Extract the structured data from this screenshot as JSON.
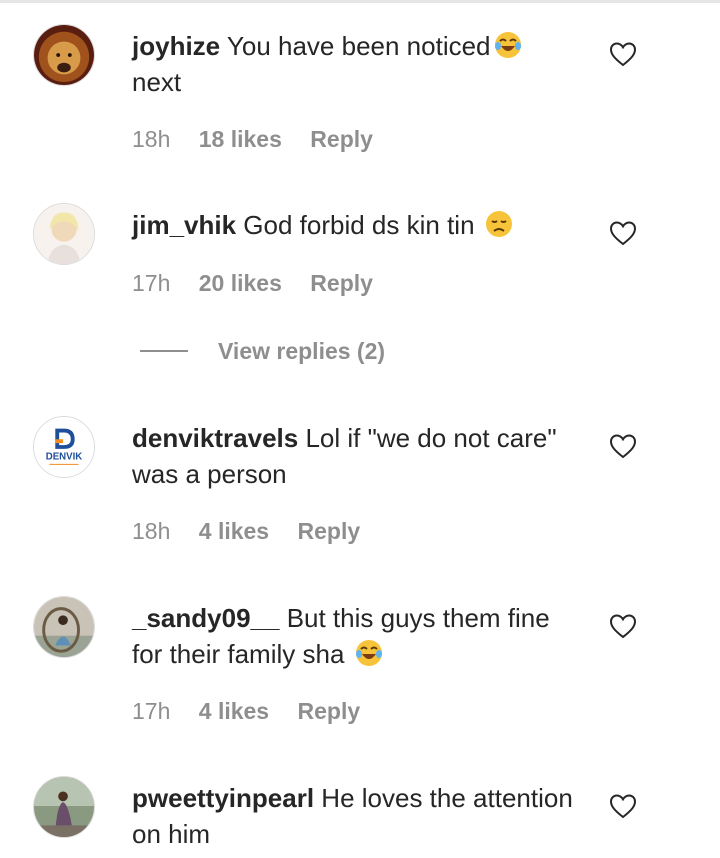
{
  "comments": [
    {
      "username": "joyhize",
      "text": "You have been noticed",
      "text2": "next",
      "emoji": "tears-of-joy-emoji",
      "time": "18h",
      "likes": "18 likes",
      "reply": "Reply"
    },
    {
      "username": "jim_vhik",
      "text": "God forbid ds kin tin",
      "emoji": "disappointed-face-emoji",
      "time": "17h",
      "likes": "20 likes",
      "reply": "Reply"
    },
    {
      "username": "denviktravels",
      "text": "Lol if \"we do not care\" was a person",
      "avatar_logo_text": "DENVIK",
      "time": "18h",
      "likes": "4 likes",
      "reply": "Reply"
    },
    {
      "username": "_sandy09__",
      "text": "But this guys them fine for their family sha",
      "emoji": "tears-of-joy-emoji",
      "time": "17h",
      "likes": "4 likes",
      "reply": "Reply"
    },
    {
      "username": "pweettyinpearl",
      "text": "He loves the attention on him"
    }
  ],
  "view_replies": "View replies (2)",
  "colors": {
    "text": "#262626",
    "meta": "#8e8e8e",
    "emoji": "#f6c33b",
    "denvik_blue": "#1f4e9a",
    "denvik_orange": "#f28c1e"
  }
}
